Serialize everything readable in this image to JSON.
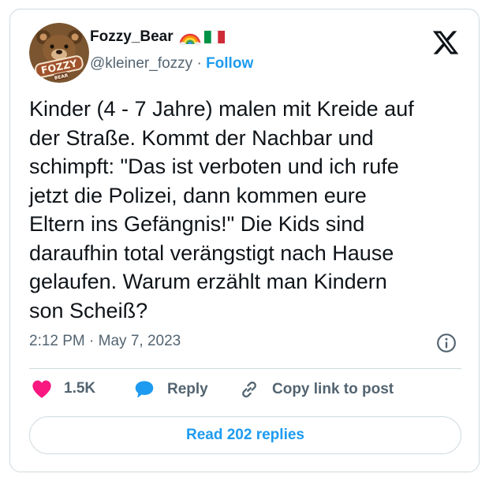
{
  "author": {
    "display_name": "Fozzy_Bear",
    "handle": "@kleiner_fozzy",
    "separator": "·",
    "follow_label": "Follow",
    "avatar_text": "FOZZY",
    "avatar_subtext": "BEAR"
  },
  "tweet": {
    "text": "Kinder (4 - 7 Jahre) malen mit Kreide auf\nder Straße. Kommt der Nachbar und\nschimpft: \"Das ist verboten und ich rufe\njetzt die Polizei, dann kommen eure\nEltern ins Gefängnis!\" Die Kids sind\ndaraufhin total verängstigt nach Hause\ngelaufen. Warum erzählt man Kindern\nson Scheiß?",
    "timestamp": "2:12 PM · May 7, 2023"
  },
  "actions": {
    "like_count": "1.5K",
    "reply_label": "Reply",
    "copy_link_label": "Copy link to post"
  },
  "read_replies_label": "Read 202 replies",
  "icons": {
    "logo": "x-logo-icon",
    "info": "info-icon",
    "like": "heart-icon",
    "reply": "speech-bubble-icon",
    "copy_link": "link-icon",
    "flags": [
      "rainbow-icon",
      "italy-flag-icon"
    ]
  },
  "colors": {
    "accent": "#1d9bf0",
    "like": "#f91880",
    "secondary_text": "#536471",
    "border": "#cfd9de"
  }
}
